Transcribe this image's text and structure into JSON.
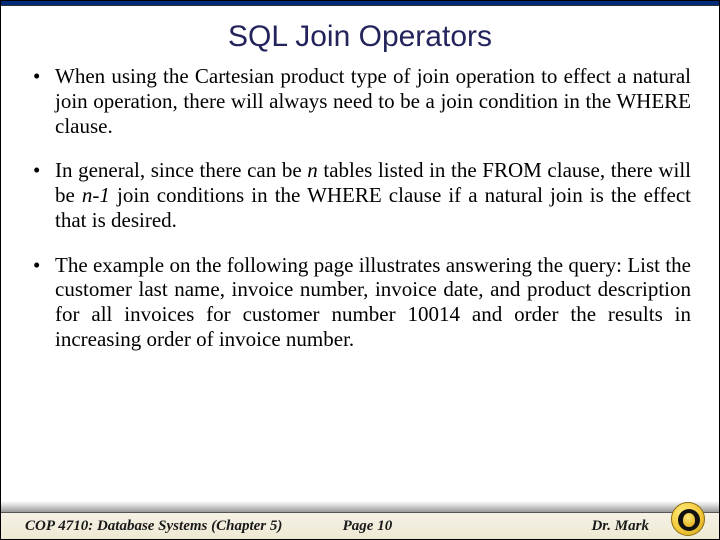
{
  "title": "SQL Join Operators",
  "bullets": [
    {
      "pre": "When using the Cartesian product type of join operation to effect a natural join operation, there will always need to be a join condition in the WHERE clause.",
      "i1": "",
      "mid": "",
      "i2": "",
      "post": ""
    },
    {
      "pre": "In general, since there can be ",
      "i1": "n",
      "mid": " tables listed in the FROM clause, there will be ",
      "i2": "n-1",
      "post": " join conditions in the WHERE clause if a natural join is the effect that is desired."
    },
    {
      "pre": "The example on the following page illustrates answering the query: List the customer last name, invoice number, invoice date, and product description for all invoices for customer number 10014 and order the results in increasing order of invoice number.",
      "i1": "",
      "mid": "",
      "i2": "",
      "post": ""
    }
  ],
  "footer": {
    "left": "COP 4710: Database Systems  (Chapter 5)",
    "center": "Page 10",
    "right": "Dr. Mark"
  }
}
